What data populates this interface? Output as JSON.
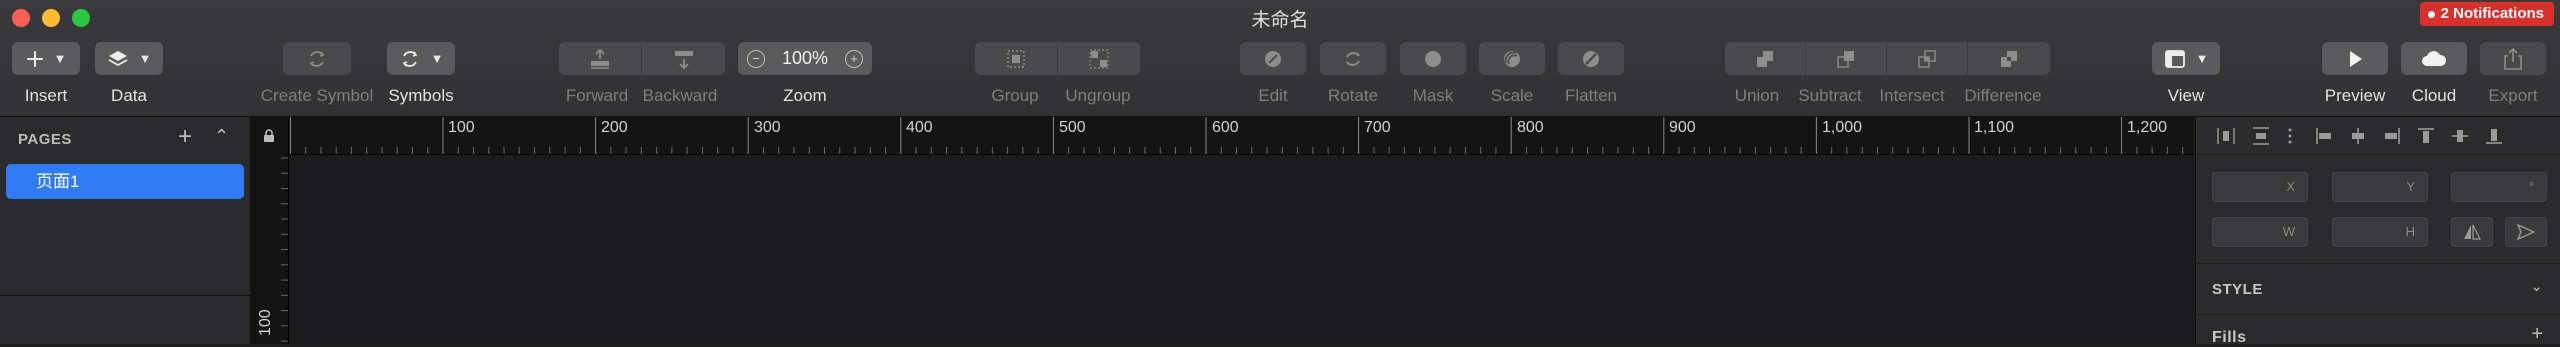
{
  "window": {
    "title": "未命名",
    "notifications": "2 Notifications"
  },
  "toolbar": {
    "insert": "Insert",
    "data": "Data",
    "create_symbol": "Create Symbol",
    "symbols": "Symbols",
    "forward": "Forward",
    "backward": "Backward",
    "zoom_label": "Zoom",
    "zoom_value": "100%",
    "zoom_minus": "−",
    "zoom_plus": "+",
    "group": "Group",
    "ungroup": "Ungroup",
    "edit": "Edit",
    "rotate": "Rotate",
    "mask": "Mask",
    "scale": "Scale",
    "flatten": "Flatten",
    "union": "Union",
    "subtract": "Subtract",
    "intersect": "Intersect",
    "difference": "Difference",
    "view": "View",
    "preview": "Preview",
    "cloud": "Cloud",
    "export": "Export"
  },
  "pages": {
    "header": "PAGES",
    "add": "+",
    "collapse": "⌃",
    "items": [
      {
        "label": "页面1",
        "selected": true
      }
    ]
  },
  "ruler": {
    "top_labels": [
      "100",
      "200",
      "300",
      "400",
      "500",
      "600",
      "700",
      "800",
      "900",
      "1,000",
      "1,100",
      "1,200"
    ],
    "left_labels": [
      "100"
    ]
  },
  "inspector": {
    "x_label": "X",
    "y_label": "Y",
    "rot_label": "°",
    "w_label": "W",
    "h_label": "H",
    "style_title": "STYLE",
    "fills_title": "Fills",
    "fills_add": "+",
    "style_chevron": "⌄"
  },
  "colors": {
    "accent": "#2f7cf6",
    "notification": "#d9302c",
    "toolbar_bg": "#3a3a3c",
    "canvas_bg": "#1c1c1e"
  }
}
